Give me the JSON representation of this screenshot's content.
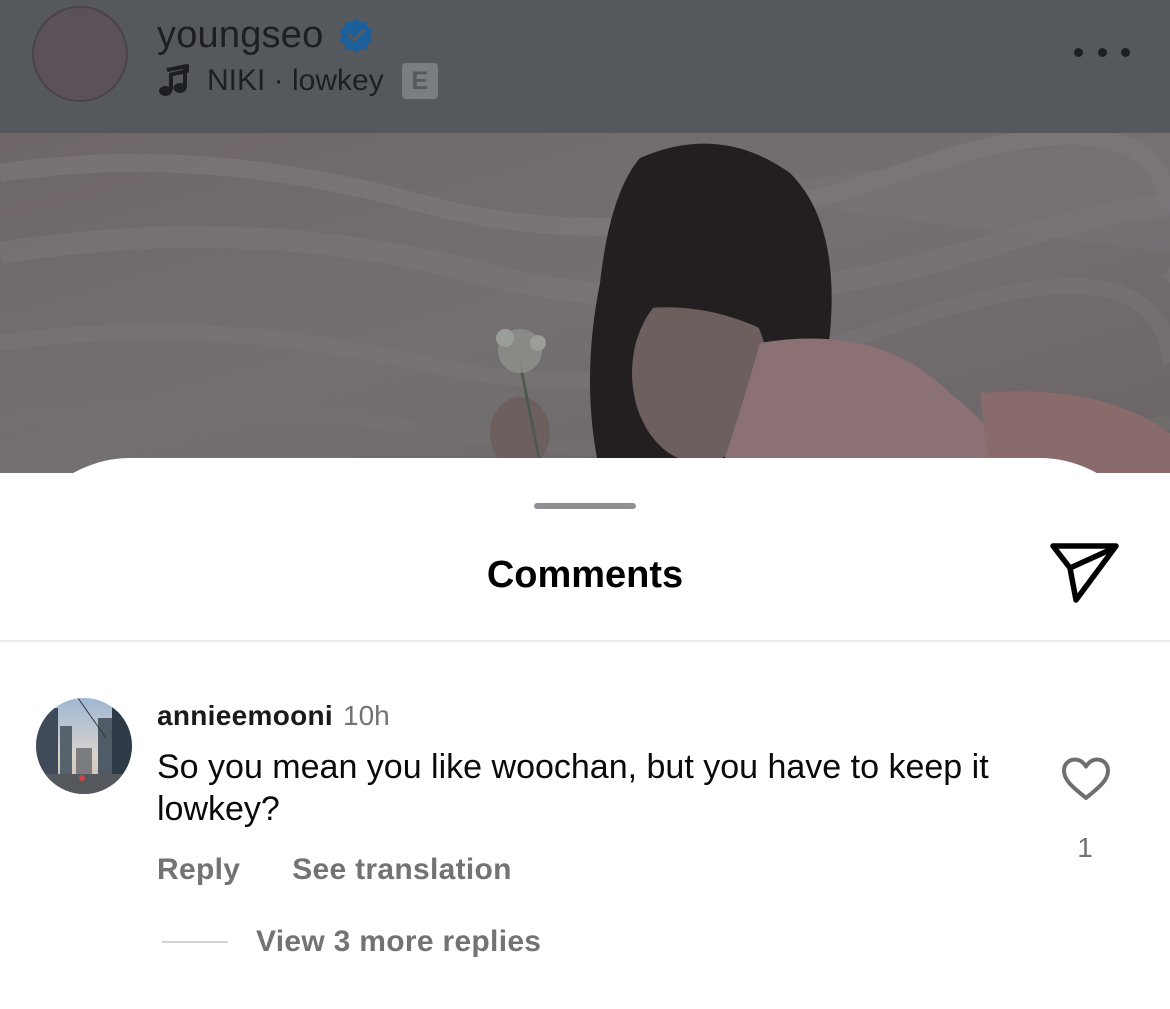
{
  "post": {
    "author": {
      "username": "youngseo",
      "verified": true,
      "verified_icon": "verified-badge-icon",
      "verified_color": "#1d5f9a"
    },
    "music": {
      "icon": "music-note-icon",
      "text": "NIKI · lowkey",
      "explicit_badge": "E"
    },
    "more_icon": "more-horizontal-icon"
  },
  "comments_sheet": {
    "title": "Comments",
    "share_icon": "send-icon",
    "comments": [
      {
        "username": "annieemooni",
        "time": "10h",
        "text": "So you mean you like woochan, but you have to keep it lowkey?",
        "reply_label": "Reply",
        "translate_label": "See translation",
        "like_icon": "heart-outline-icon",
        "like_count": "1",
        "view_replies_label": "View 3 more replies"
      }
    ]
  },
  "colors": {
    "overlay_header": "#55595d",
    "secondary_text": "#737373",
    "sheet_background": "#ffffff"
  }
}
